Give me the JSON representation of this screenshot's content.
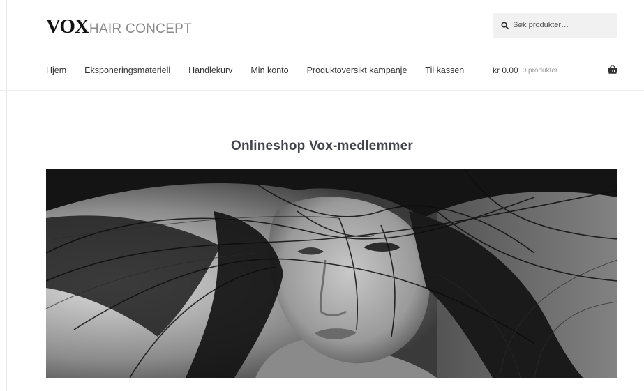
{
  "brand": {
    "logo_mark": "VOX",
    "logo_text": "HAIR CONCEPT"
  },
  "search": {
    "placeholder": "Søk produkter…",
    "icon": "search-icon"
  },
  "nav": {
    "items": [
      {
        "label": "Hjem"
      },
      {
        "label": "Eksponeringsmateriell"
      },
      {
        "label": "Handlekurv"
      },
      {
        "label": "Min konto"
      },
      {
        "label": "Produktoversikt kampanje"
      },
      {
        "label": "Til kassen"
      }
    ]
  },
  "cart": {
    "amount": "kr 0.00",
    "count_label": "0 produkter",
    "icon": "basket-icon"
  },
  "main": {
    "title": "Onlineshop Vox-medlemmer"
  },
  "colors": {
    "text": "#333333",
    "muted": "#9a9a9a",
    "search_bg": "#f1f1f1",
    "logo": "#111111"
  }
}
